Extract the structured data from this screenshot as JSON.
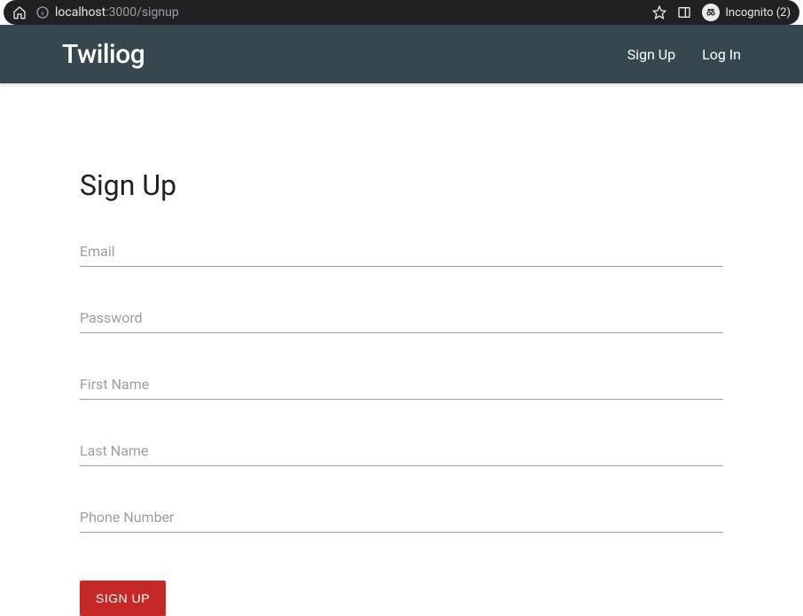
{
  "browser": {
    "url_host": "localhost",
    "url_port_path": ":3000/signup",
    "incognito_label": "Incognito (2)"
  },
  "navbar": {
    "brand": "Twiliog",
    "links": {
      "signup": "Sign Up",
      "login": "Log In"
    }
  },
  "page": {
    "title": "Sign Up",
    "fields": {
      "email": {
        "label": "Email",
        "value": ""
      },
      "password": {
        "label": "Password",
        "value": ""
      },
      "first_name": {
        "label": "First Name",
        "value": ""
      },
      "last_name": {
        "label": "Last Name",
        "value": ""
      },
      "phone": {
        "label": "Phone Number",
        "value": ""
      }
    },
    "submit_label": "SIGN UP"
  },
  "colors": {
    "navbar_bg": "#37474f",
    "submit_bg": "#c62828"
  }
}
